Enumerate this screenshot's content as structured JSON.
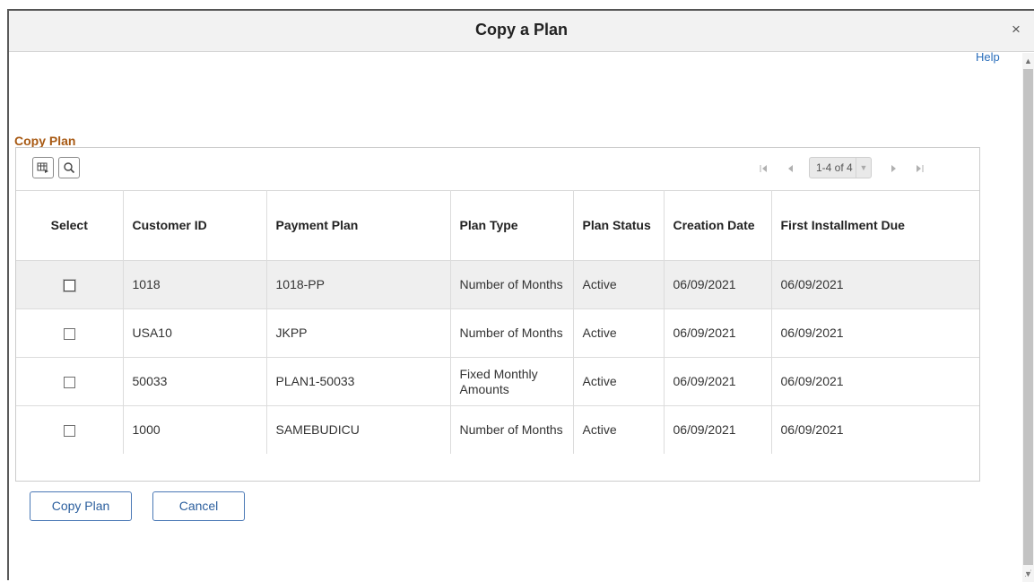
{
  "modal": {
    "title": "Copy a Plan",
    "close_glyph": "×",
    "help_label": "Help"
  },
  "section": {
    "title": "Copy Plan"
  },
  "grid": {
    "toolbar": {
      "personalize_icon": "grid-personalize-icon",
      "find_icon": "search-icon"
    },
    "pager": {
      "range_label": "1-4 of 4"
    },
    "columns": [
      "Select",
      "Customer ID",
      "Payment Plan",
      "Plan Type",
      "Plan Status",
      "Creation Date",
      "First Installment Due"
    ],
    "rows": [
      {
        "customer_id": "1018",
        "payment_plan": "1018-PP",
        "plan_type": "Number of Months",
        "plan_status": "Active",
        "creation_date": "06/09/2021",
        "first_installment_due": "06/09/2021"
      },
      {
        "customer_id": "USA10",
        "payment_plan": "JKPP",
        "plan_type": "Number of Months",
        "plan_status": "Active",
        "creation_date": "06/09/2021",
        "first_installment_due": "06/09/2021"
      },
      {
        "customer_id": "50033",
        "payment_plan": "PLAN1-50033",
        "plan_type": "Fixed Monthly Amounts",
        "plan_status": "Active",
        "creation_date": "06/09/2021",
        "first_installment_due": "06/09/2021"
      },
      {
        "customer_id": "1000",
        "payment_plan": "SAMEBUDICU",
        "plan_type": "Number of Months",
        "plan_status": "Active",
        "creation_date": "06/09/2021",
        "first_installment_due": "06/09/2021"
      }
    ]
  },
  "actions": {
    "copy_label": "Copy Plan",
    "cancel_label": "Cancel"
  },
  "colors": {
    "section_title": "#a85a14",
    "link": "#2a6ebb",
    "button_border": "#4a78b5",
    "header_bg": "#f2f2f2",
    "highlight_row": "#efefef"
  }
}
